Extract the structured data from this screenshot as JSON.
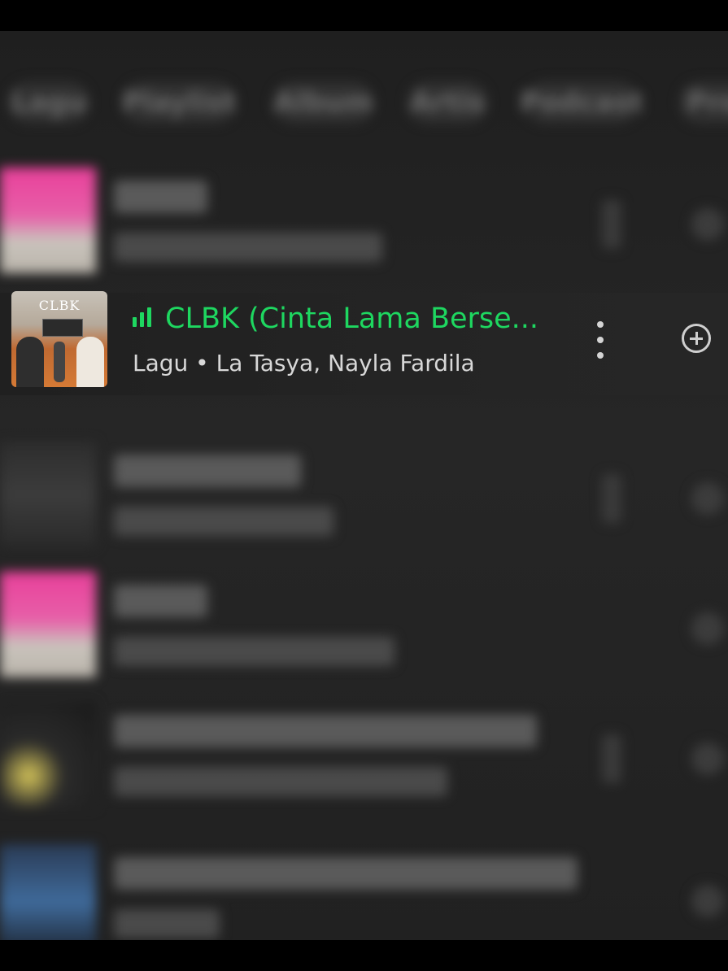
{
  "filter_chips": [
    "Lagu",
    "Playlist",
    "Album",
    "Artis",
    "Podcast",
    "Profil"
  ],
  "focused_track": {
    "title": "CLBK (Cinta Lama Berse...",
    "subtitle": "Lagu • La Tasya, Nayla Fardila",
    "cover_text": "CLBK",
    "playing_indicator": "equalizer-bars",
    "accent_color": "#1ed760"
  },
  "icons": [
    "equalizer-icon",
    "more-options-icon",
    "add-circle-icon"
  ]
}
